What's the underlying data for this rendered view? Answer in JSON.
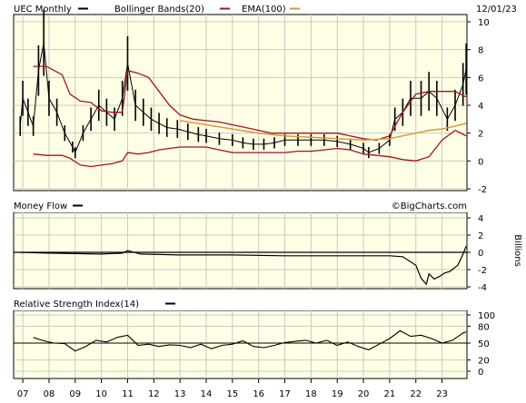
{
  "symbol_label": "UEC Monthly",
  "date_label": "12/01/23",
  "watermark": "©BigCharts.com",
  "colors": {
    "panel_bg": "#ffffe6",
    "grid": "#c8c8c8",
    "price": "#000000",
    "bollinger": "#a31515",
    "ema": "#d49a3a"
  },
  "chart_data": [
    {
      "type": "candlestick",
      "title": "UEC Monthly",
      "legend": [
        {
          "label": "UEC Monthly",
          "color": "#000000"
        },
        {
          "label": "Bollinger Bands(20)",
          "color": "#a31515"
        },
        {
          "label": "EMA(100)",
          "color": "#d49a3a"
        }
      ],
      "legend_placement": "top",
      "ylim": [
        -2,
        10
      ],
      "yticks": [
        -2,
        0,
        2,
        4,
        6,
        8,
        10
      ],
      "grid": true,
      "x_ticks": [
        "07",
        "08",
        "09",
        "10",
        "11",
        "12",
        "13",
        "14",
        "15",
        "16",
        "17",
        "18",
        "19",
        "20",
        "21",
        "22",
        "23"
      ],
      "series": [
        {
          "name": "UEC Monthly",
          "x": [
            2006.9,
            2007.0,
            2007.2,
            2007.4,
            2007.6,
            2007.8,
            2008.0,
            2008.3,
            2008.6,
            2008.9,
            2009.0,
            2009.3,
            2009.6,
            2009.9,
            2010.2,
            2010.5,
            2010.8,
            2011.0,
            2011.3,
            2011.6,
            2011.9,
            2012.2,
            2012.5,
            2012.9,
            2013.3,
            2013.7,
            2014.0,
            2014.5,
            2015.0,
            2015.4,
            2015.8,
            2016.2,
            2016.6,
            2017.0,
            2017.5,
            2018.0,
            2018.5,
            2019.0,
            2019.5,
            2020.0,
            2020.2,
            2020.6,
            2021.0,
            2021.2,
            2021.5,
            2021.8,
            2022.2,
            2022.5,
            2022.8,
            2023.2,
            2023.5,
            2023.8,
            2023.92
          ],
          "values": [
            2.5,
            4.5,
            3.5,
            2.5,
            6.5,
            8.5,
            4.5,
            3.5,
            2.0,
            1.0,
            0.6,
            2.0,
            3.0,
            4.0,
            3.5,
            3.0,
            4.5,
            7.0,
            4.0,
            3.5,
            3.0,
            2.7,
            2.4,
            2.3,
            2.1,
            1.9,
            1.8,
            1.6,
            1.5,
            1.3,
            1.2,
            1.2,
            1.3,
            1.5,
            1.5,
            1.5,
            1.5,
            1.4,
            1.2,
            0.9,
            0.6,
            0.9,
            1.5,
            3.0,
            3.5,
            4.5,
            4.5,
            5.0,
            4.5,
            3.0,
            4.0,
            5.5,
            6.6
          ]
        },
        {
          "name": "Bollinger Bands(20)",
          "x": [
            2007.4,
            2007.9,
            2008.5,
            2008.8,
            2009.2,
            2009.6,
            2010.0,
            2010.4,
            2010.8,
            2011.0,
            2011.4,
            2011.8,
            2012.2,
            2012.6,
            2013.0,
            2013.5,
            2014.0,
            2014.5,
            2015.0,
            2015.5,
            2016.0,
            2016.5,
            2017.0,
            2017.5,
            2018.0,
            2018.5,
            2019.0,
            2019.5,
            2020.0,
            2020.5,
            2021.0,
            2021.5,
            2022.0,
            2022.5,
            2023.0,
            2023.5,
            2023.92
          ],
          "values": [
            6.8,
            6.8,
            6.2,
            4.8,
            4.3,
            4.2,
            3.6,
            3.5,
            3.5,
            6.5,
            6.3,
            6.0,
            5.0,
            4.0,
            3.3,
            3.0,
            2.9,
            2.8,
            2.6,
            2.4,
            2.2,
            2.0,
            2.0,
            2.0,
            2.0,
            2.0,
            2.0,
            1.8,
            1.6,
            1.5,
            1.8,
            3.5,
            4.8,
            5.0,
            5.0,
            5.0,
            4.6
          ]
        },
        {
          "name": "Bollinger Bands(20) lower",
          "x": [
            2007.4,
            2007.9,
            2008.5,
            2008.8,
            2009.2,
            2009.6,
            2010.0,
            2010.4,
            2010.8,
            2011.0,
            2011.4,
            2011.8,
            2012.2,
            2012.6,
            2013.0,
            2013.5,
            2014.0,
            2014.5,
            2015.0,
            2015.5,
            2016.0,
            2016.5,
            2017.0,
            2017.5,
            2018.0,
            2018.5,
            2019.0,
            2019.5,
            2020.0,
            2020.5,
            2021.0,
            2021.5,
            2022.0,
            2022.5,
            2023.0,
            2023.5,
            2023.92
          ],
          "values": [
            0.5,
            0.4,
            0.4,
            0.2,
            -0.3,
            -0.4,
            -0.3,
            -0.2,
            0.0,
            0.6,
            0.5,
            0.6,
            0.8,
            0.9,
            1.0,
            1.0,
            1.0,
            0.8,
            0.6,
            0.6,
            0.6,
            0.6,
            0.6,
            0.7,
            0.7,
            0.8,
            0.9,
            0.8,
            0.5,
            0.4,
            0.3,
            0.1,
            0.0,
            0.3,
            1.5,
            2.2,
            1.8
          ]
        },
        {
          "name": "EMA(100)",
          "x": [
            2013.0,
            2014.0,
            2015.0,
            2016.0,
            2017.0,
            2018.0,
            2019.0,
            2020.0,
            2021.0,
            2021.5,
            2022.0,
            2022.5,
            2023.0,
            2023.5,
            2023.92
          ],
          "values": [
            2.9,
            2.6,
            2.3,
            2.0,
            1.8,
            1.7,
            1.6,
            1.5,
            1.6,
            1.8,
            2.0,
            2.2,
            2.3,
            2.5,
            2.7
          ]
        }
      ]
    },
    {
      "type": "line",
      "title": "Money Flow",
      "ylabel": "Billions",
      "ylim": [
        -4,
        4
      ],
      "yticks": [
        -4,
        -2,
        0,
        2,
        4
      ],
      "grid": true,
      "series": [
        {
          "name": "Money Flow",
          "x": [
            2006.9,
            2008.0,
            2010.0,
            2010.8,
            2011.0,
            2011.5,
            2013.0,
            2015.0,
            2017.0,
            2019.0,
            2020.0,
            2021.0,
            2021.5,
            2022.0,
            2022.2,
            2022.4,
            2022.5,
            2022.7,
            2022.9,
            2023.1,
            2023.3,
            2023.6,
            2023.8,
            2023.92
          ],
          "values": [
            0.0,
            -0.1,
            -0.2,
            -0.1,
            0.2,
            -0.2,
            -0.3,
            -0.3,
            -0.4,
            -0.4,
            -0.4,
            -0.4,
            -0.5,
            -1.5,
            -3.0,
            -3.7,
            -2.5,
            -3.1,
            -2.8,
            -2.4,
            -2.2,
            -1.5,
            -0.2,
            0.7
          ]
        }
      ]
    },
    {
      "type": "line",
      "title": "Relative Strength Index(14)",
      "ylim": [
        0,
        100
      ],
      "yticks": [
        0,
        20,
        50,
        80,
        100
      ],
      "grid": true,
      "series": [
        {
          "name": "Relative Strength Index(14)",
          "x": [
            2007.4,
            2007.8,
            2008.2,
            2008.6,
            2009.0,
            2009.4,
            2009.8,
            2010.2,
            2010.6,
            2011.0,
            2011.4,
            2011.8,
            2012.2,
            2012.6,
            2013.0,
            2013.4,
            2013.8,
            2014.2,
            2014.6,
            2015.0,
            2015.4,
            2015.8,
            2016.2,
            2016.6,
            2017.0,
            2017.4,
            2017.8,
            2018.2,
            2018.6,
            2019.0,
            2019.4,
            2019.8,
            2020.2,
            2020.6,
            2021.0,
            2021.4,
            2021.8,
            2022.2,
            2022.6,
            2023.0,
            2023.4,
            2023.8,
            2023.92
          ],
          "values": [
            60,
            54,
            50,
            49,
            36,
            44,
            55,
            52,
            60,
            64,
            46,
            48,
            44,
            47,
            46,
            42,
            48,
            40,
            46,
            48,
            54,
            44,
            42,
            46,
            51,
            53,
            55,
            50,
            55,
            46,
            52,
            44,
            38,
            48,
            58,
            72,
            62,
            64,
            58,
            50,
            55,
            68,
            70
          ]
        }
      ]
    }
  ]
}
